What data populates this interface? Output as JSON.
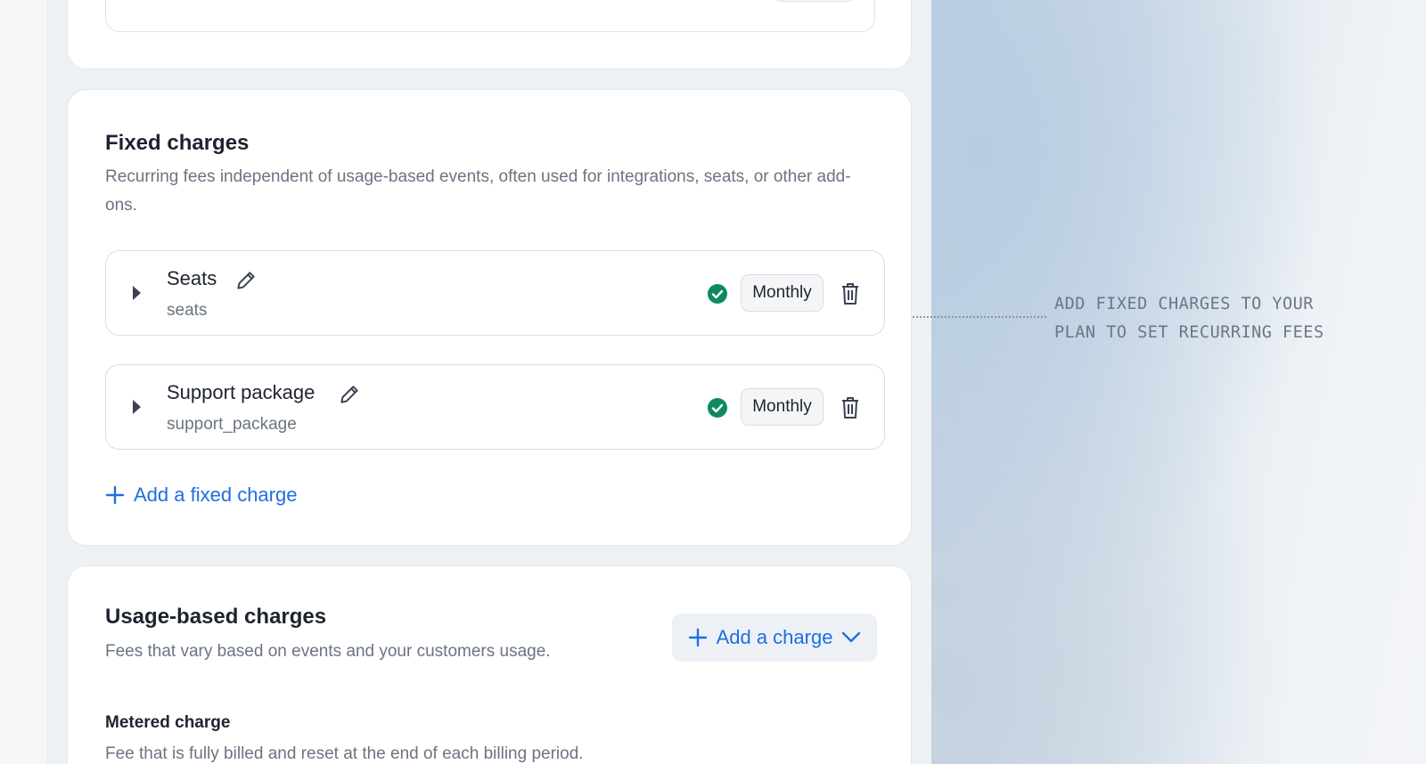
{
  "fixed_charges": {
    "title": "Fixed charges",
    "description": "Recurring fees independent of usage-based events, often used for integrations, seats, or other add-ons.",
    "items": [
      {
        "name": "Seats",
        "code": "seats",
        "period": "Monthly",
        "status": "valid"
      },
      {
        "name": "Support package",
        "code": "support_package",
        "period": "Monthly",
        "status": "valid"
      }
    ],
    "add_label": "Add a fixed charge"
  },
  "usage_charges": {
    "title": "Usage-based charges",
    "description": "Fees that vary based on events and your customers usage.",
    "add_label": "Add a charge",
    "metered": {
      "title": "Metered charge",
      "description": "Fee that is fully billed and reset at the end of each billing period."
    }
  },
  "annotation": {
    "line1": "ADD FIXED CHARGES TO YOUR",
    "line2": "PLAN TO SET RECURRING FEES"
  },
  "colors": {
    "accent": "#1f6fe0",
    "success": "#0d8a5e",
    "text": "#1d2330",
    "muted": "#6b7482"
  },
  "icons": {
    "edit": "pencil-icon",
    "status": "check-circle-icon",
    "delete": "trash-icon",
    "expand": "caret-right-icon",
    "add": "plus-icon",
    "dropdown": "chevron-down-icon"
  }
}
